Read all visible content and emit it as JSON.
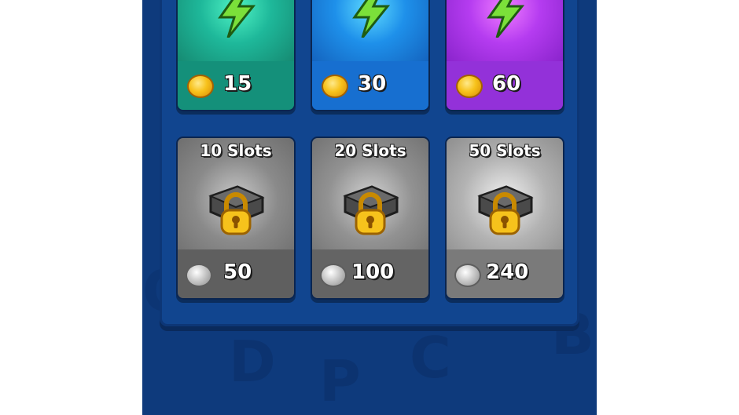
{
  "energy_packs": [
    {
      "price": "15",
      "color": "#1aa88a"
    },
    {
      "price": "30",
      "color": "#1b7fe0"
    },
    {
      "price": "60",
      "color": "#9b36e3"
    }
  ],
  "slot_packs": [
    {
      "label": "10 Slots",
      "price": "50"
    },
    {
      "label": "20 Slots",
      "price": "100"
    },
    {
      "label": "50 Slots",
      "price": "240"
    }
  ],
  "icons": {
    "energy": "lightning-bolt-icon",
    "gold": "gold-coin-icon",
    "silver": "silver-coin-icon",
    "lock": "padlock-icon",
    "chest": "gray-box-icon"
  },
  "colors": {
    "background": "#0e3a7c",
    "panel": "#11458f",
    "gold": "#f7c21b",
    "slot_card": "#6b6b6b"
  }
}
